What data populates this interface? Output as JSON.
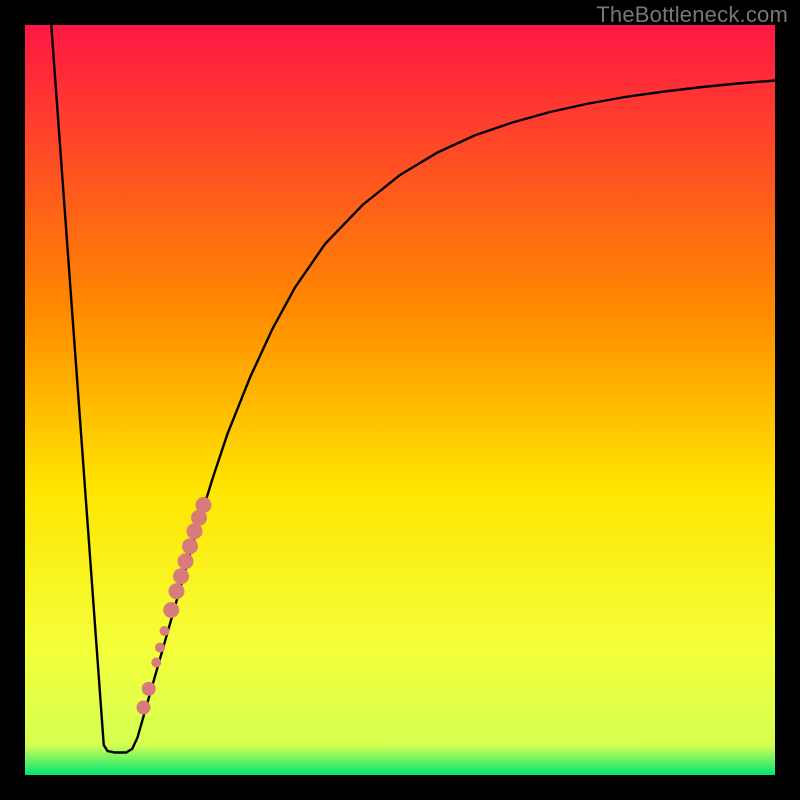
{
  "watermark": "TheBottleneck.com",
  "chart_data": {
    "type": "line",
    "title": "",
    "xlabel": "",
    "ylabel": "",
    "ylim": [
      0,
      100
    ],
    "xlim": [
      0,
      100
    ],
    "gradient_colors": {
      "top": "#ff1744",
      "mid_upper": "#ff8a00",
      "mid": "#ffe600",
      "lower": "#f4ff3a",
      "bottom": "#00e676"
    },
    "curve_points": [
      {
        "x": 3.5,
        "y": 100
      },
      {
        "x": 10.5,
        "y": 4
      },
      {
        "x": 11,
        "y": 3.2
      },
      {
        "x": 12,
        "y": 3
      },
      {
        "x": 13.5,
        "y": 3
      },
      {
        "x": 14.3,
        "y": 3.5
      },
      {
        "x": 15,
        "y": 5
      },
      {
        "x": 17,
        "y": 12
      },
      {
        "x": 19,
        "y": 19
      },
      {
        "x": 21,
        "y": 26
      },
      {
        "x": 23,
        "y": 33
      },
      {
        "x": 25,
        "y": 39.5
      },
      {
        "x": 27,
        "y": 45.5
      },
      {
        "x": 30,
        "y": 53
      },
      {
        "x": 33,
        "y": 59.5
      },
      {
        "x": 36,
        "y": 65
      },
      {
        "x": 40,
        "y": 70.8
      },
      {
        "x": 45,
        "y": 76
      },
      {
        "x": 50,
        "y": 80
      },
      {
        "x": 55,
        "y": 83
      },
      {
        "x": 60,
        "y": 85.3
      },
      {
        "x": 65,
        "y": 87
      },
      {
        "x": 70,
        "y": 88.4
      },
      {
        "x": 75,
        "y": 89.5
      },
      {
        "x": 80,
        "y": 90.4
      },
      {
        "x": 85,
        "y": 91.1
      },
      {
        "x": 90,
        "y": 91.7
      },
      {
        "x": 95,
        "y": 92.2
      },
      {
        "x": 100,
        "y": 92.6
      }
    ],
    "marker_points": [
      {
        "x": 15.8,
        "y": 9.0,
        "r": 7
      },
      {
        "x": 16.5,
        "y": 11.5,
        "r": 7
      },
      {
        "x": 17.5,
        "y": 15.0,
        "r": 5
      },
      {
        "x": 18.0,
        "y": 17.0,
        "r": 5
      },
      {
        "x": 18.6,
        "y": 19.2,
        "r": 5
      },
      {
        "x": 19.5,
        "y": 22.0,
        "r": 8
      },
      {
        "x": 20.2,
        "y": 24.5,
        "r": 8
      },
      {
        "x": 20.8,
        "y": 26.5,
        "r": 8
      },
      {
        "x": 21.4,
        "y": 28.5,
        "r": 8
      },
      {
        "x": 22.0,
        "y": 30.5,
        "r": 8
      },
      {
        "x": 22.6,
        "y": 32.5,
        "r": 8
      },
      {
        "x": 23.2,
        "y": 34.3,
        "r": 8
      },
      {
        "x": 23.8,
        "y": 36.0,
        "r": 8
      }
    ],
    "marker_color": "#d77b7b",
    "curve_color": "#000000"
  }
}
